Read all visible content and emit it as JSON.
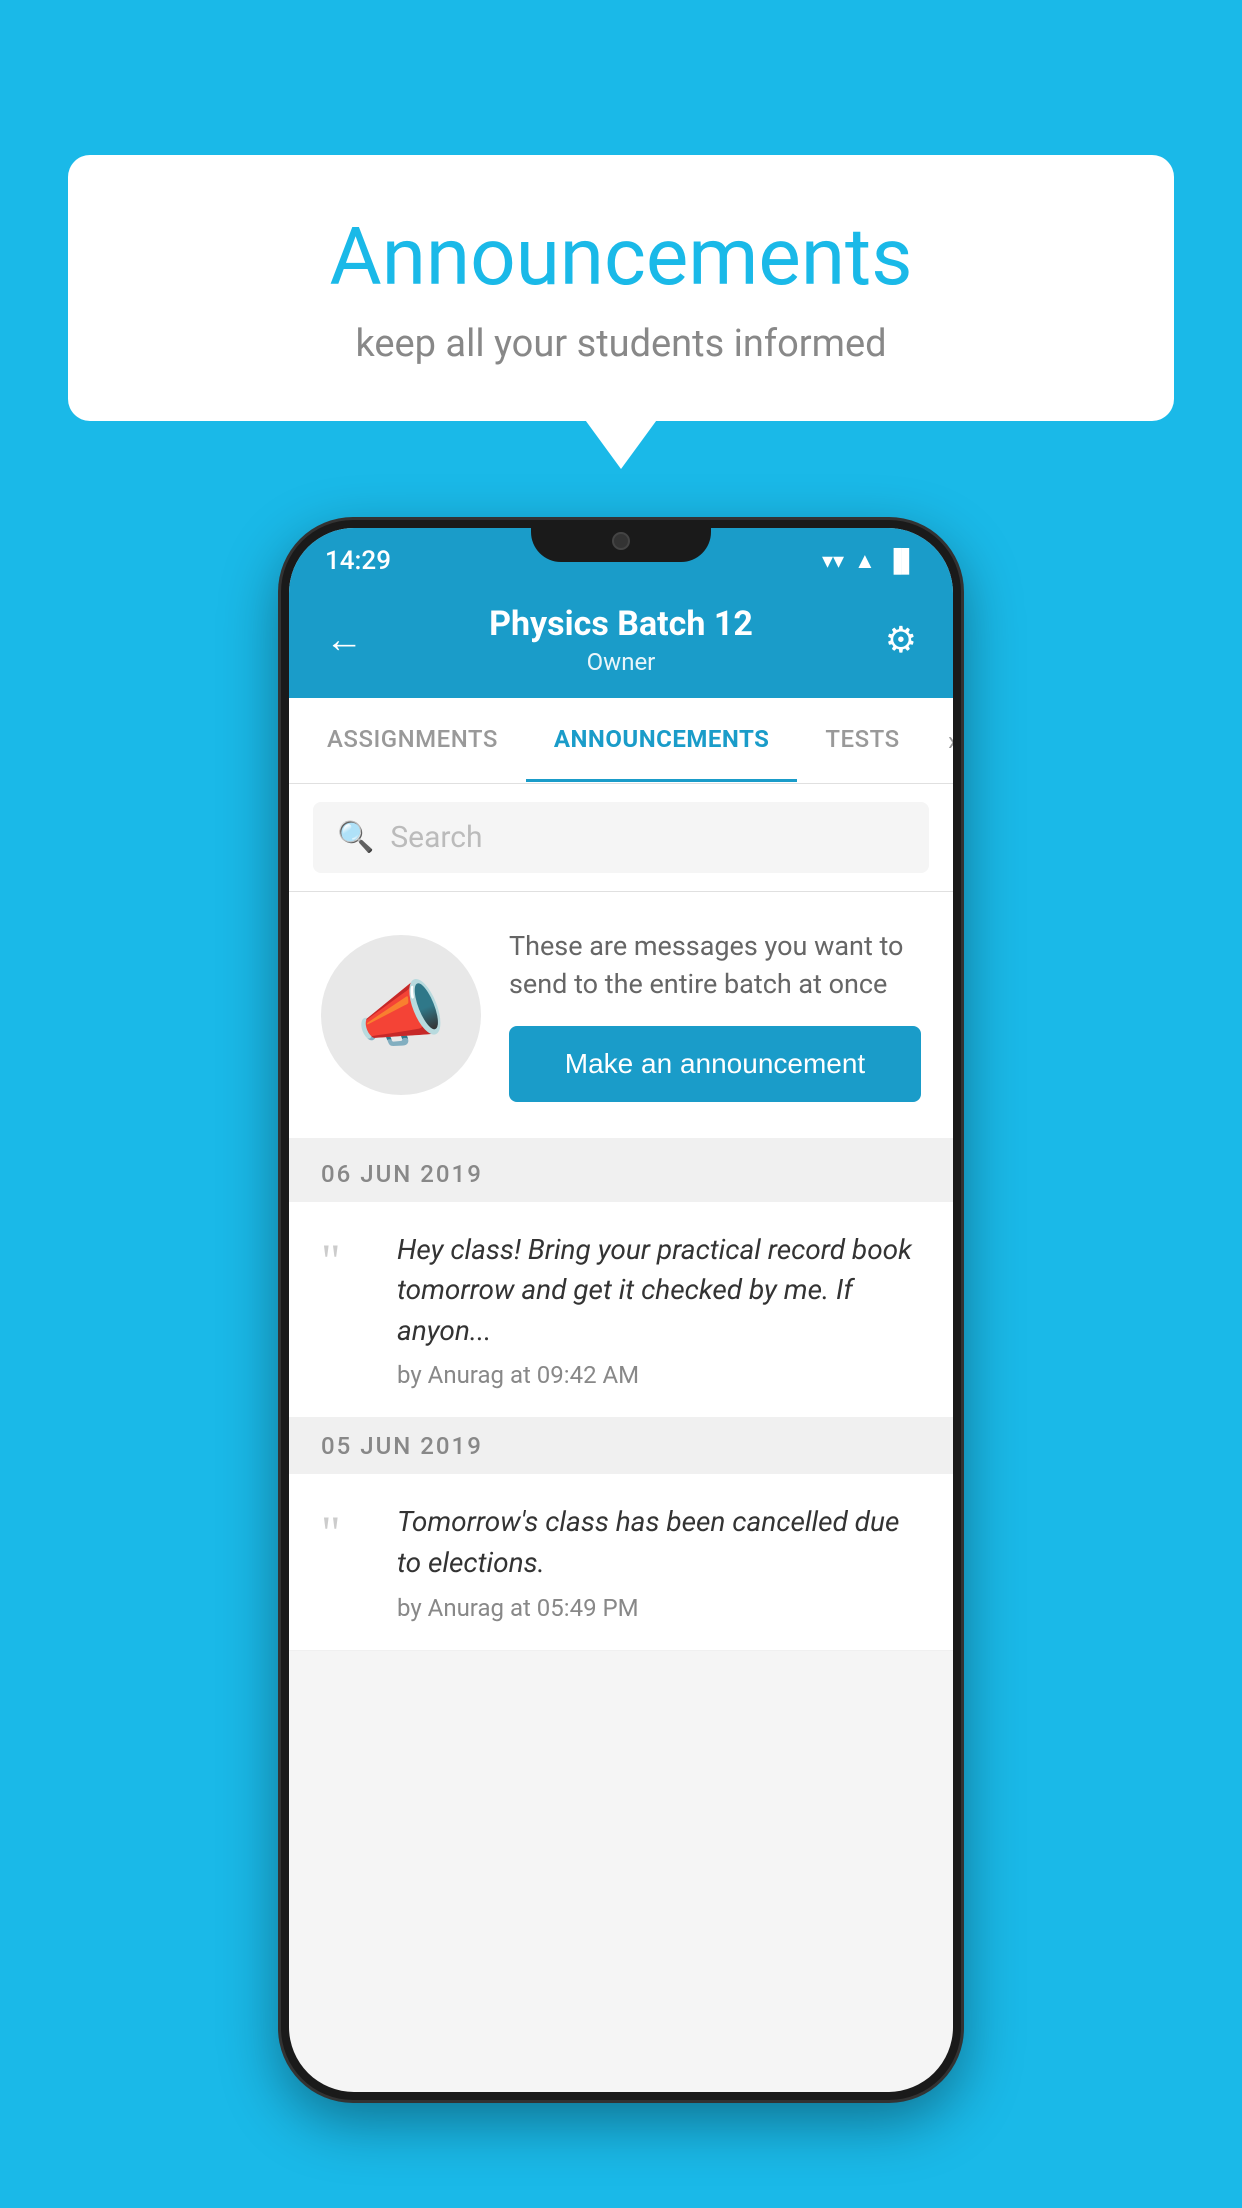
{
  "background_color": "#1ab9e8",
  "speech_bubble": {
    "title": "Announcements",
    "subtitle": "keep all your students informed"
  },
  "status_bar": {
    "time": "14:29",
    "wifi": "▼",
    "signal": "▲",
    "battery": "▐"
  },
  "header": {
    "title": "Physics Batch 12",
    "subtitle": "Owner",
    "back_label": "←",
    "settings_label": "⚙"
  },
  "tabs": [
    {
      "label": "ASSIGNMENTS",
      "active": false
    },
    {
      "label": "ANNOUNCEMENTS",
      "active": true
    },
    {
      "label": "TESTS",
      "active": false
    }
  ],
  "search": {
    "placeholder": "Search"
  },
  "cta_card": {
    "description": "These are messages you want to send to the entire batch at once",
    "button_label": "Make an announcement"
  },
  "date_groups": [
    {
      "date": "06  JUN  2019",
      "announcements": [
        {
          "text": "Hey class! Bring your practical record book tomorrow and get it checked by me. If anyon...",
          "meta": "by Anurag at 09:42 AM"
        }
      ]
    },
    {
      "date": "05  JUN  2019",
      "announcements": [
        {
          "text": "Tomorrow's class has been cancelled due to elections.",
          "meta": "by Anurag at 05:49 PM"
        }
      ]
    }
  ]
}
